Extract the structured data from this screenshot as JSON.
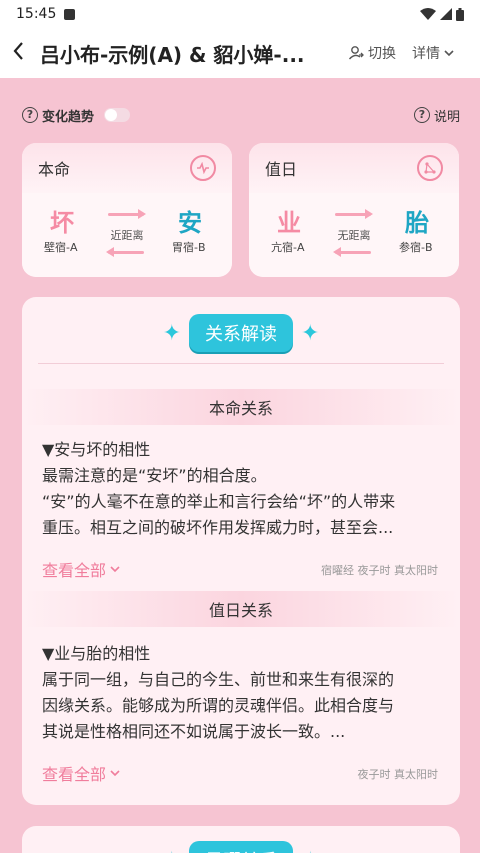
{
  "status_bar": {
    "time": "15:45"
  },
  "header": {
    "back_icon": "back-chevron-icon",
    "title": "吕小布-示例(A) & 貂小婵-...",
    "switch_label": "切换",
    "detail_label": "详情"
  },
  "trend": {
    "label": "变化趋势",
    "toggle_on": false,
    "help_label": "说明"
  },
  "cards": [
    {
      "label": "本命",
      "left_char": "坏",
      "left_sub": "壁宿-A",
      "middle": "近距离",
      "right_char": "安",
      "right_sub": "胃宿-B"
    },
    {
      "label": "值日",
      "left_char": "业",
      "left_sub": "亢宿-A",
      "middle": "无距离",
      "right_char": "胎",
      "right_sub": "参宿-B"
    }
  ],
  "panel": {
    "badge": "关系解读",
    "sections": [
      {
        "head": "本命关系",
        "lines": [
          "▼安与坏的相性",
          "最需注意的是“安坏”的相合度。",
          "“安”的人毫不在意的举止和言行会给“坏”的人带来",
          "重压。相互之间的破坏作用发挥威力时，甚至会..."
        ],
        "view_all": "查看全部",
        "meta": "宿曜经 夜子时 真太阳时"
      },
      {
        "head": "值日关系",
        "lines": [
          "▼业与胎的相性",
          "属于同一组，与自己的今生、前世和来生有很深的",
          "因缘关系。能够成为所谓的灵魂伴侣。此相合度与",
          "其说是性格相同还不如说属于波长一致。..."
        ],
        "view_all": "查看全部",
        "meta": "夜子时 真太阳时"
      }
    ]
  },
  "panel2": {
    "badge": "星曜关系"
  },
  "colors": {
    "background": "#f6c4d2",
    "accent_pink": "#f07d9c",
    "accent_cyan": "#2ec4dc"
  }
}
